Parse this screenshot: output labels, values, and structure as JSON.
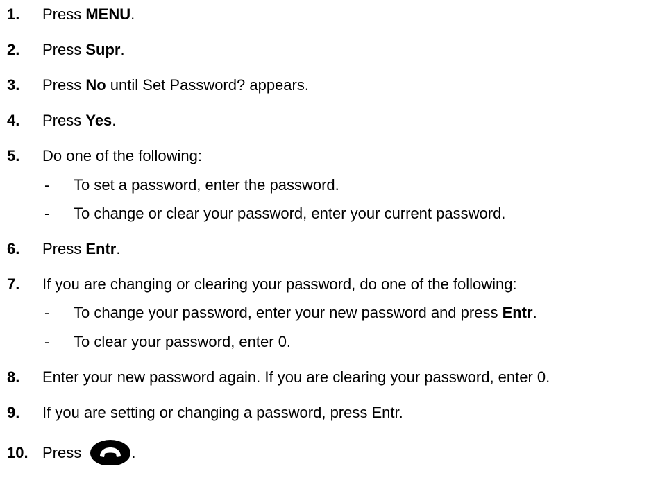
{
  "steps": [
    {
      "num": "1.",
      "before": "Press ",
      "bold": "MENU",
      "after": "."
    },
    {
      "num": "2.",
      "before": "Press ",
      "bold": "Supr",
      "after": "."
    },
    {
      "num": "3.",
      "before": "Press ",
      "bold": "No",
      "after": " until Set Password? appears."
    },
    {
      "num": "4.",
      "before": "Press ",
      "bold": "Yes",
      "after": "."
    },
    {
      "num": "5.",
      "text": "Do one of the following:"
    },
    {
      "num": "6.",
      "before": "Press ",
      "bold": "Entr",
      "after": "."
    },
    {
      "num": "7.",
      "text": "If you are changing or clearing your password, do one of the following:"
    },
    {
      "num": "8.",
      "text": "Enter your new password again. If you are clearing your password, enter 0."
    },
    {
      "num": "9.",
      "text": "If you are setting or changing a password, press Entr."
    },
    {
      "num": "10.",
      "before": "Press ",
      "after": "."
    }
  ],
  "step5_subs": [
    {
      "dash": "-",
      "text": "To set a password, enter the password."
    },
    {
      "dash": "-",
      "text": "To change or clear your password, enter your current password."
    }
  ],
  "step7_subs": [
    {
      "dash": "-",
      "before": "To change your password, enter your new password and press ",
      "bold": "Entr",
      "after": "."
    },
    {
      "dash": "-",
      "text": "To clear your password, enter 0."
    }
  ],
  "icons": {
    "step10_icon": "end-call-handset-icon"
  },
  "colors": {
    "text": "#000000",
    "background": "#ffffff"
  }
}
